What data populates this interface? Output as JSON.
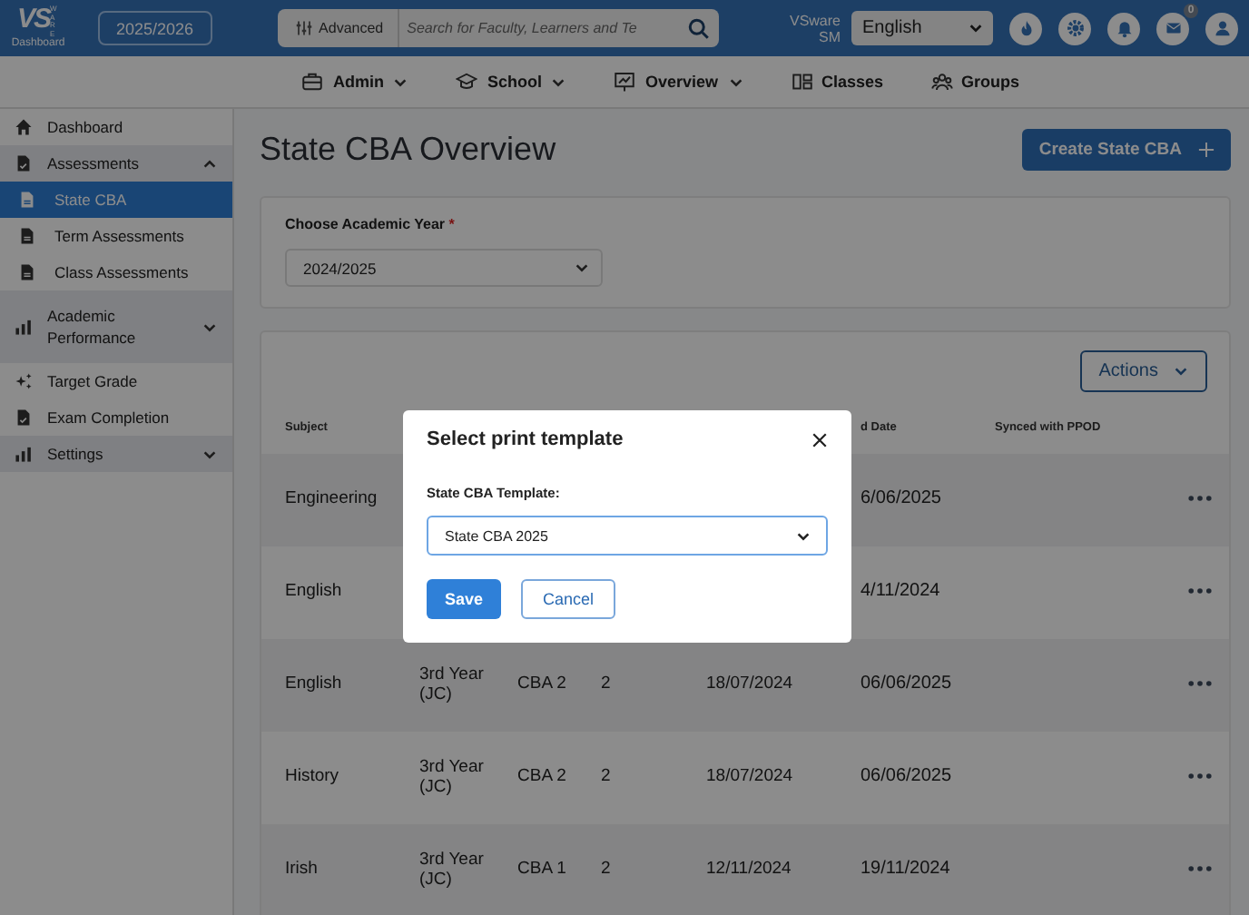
{
  "header": {
    "logo": {
      "mark": "VS",
      "side": "WARE",
      "caption": "Dashboard"
    },
    "year": "2025/2026",
    "advanced": "Advanced",
    "search": {
      "placeholder": "Search for Faculty, Learners and Te"
    },
    "org": [
      "VSware",
      "SM"
    ],
    "language": "English",
    "mail_badge": "0"
  },
  "nav": [
    {
      "label": "Admin",
      "caret": true
    },
    {
      "label": "School",
      "caret": true
    },
    {
      "label": "Overview",
      "caret": true
    },
    {
      "label": "Classes",
      "caret": false
    },
    {
      "label": "Groups",
      "caret": false
    }
  ],
  "sidebar": [
    {
      "label": "Dashboard",
      "kind": "link",
      "selected": false
    },
    {
      "label": "Assessments",
      "kind": "group",
      "expanded": true,
      "children": [
        {
          "label": "State CBA",
          "selected": true
        },
        {
          "label": "Term Assessments",
          "selected": false
        },
        {
          "label": "Class Assessments",
          "selected": false
        }
      ]
    },
    {
      "label": "Academic Performance",
      "kind": "group",
      "expanded": false
    },
    {
      "label": "Target Grade",
      "kind": "link",
      "selected": false
    },
    {
      "label": "Exam Completion",
      "kind": "link",
      "selected": false
    },
    {
      "label": "Settings",
      "kind": "group",
      "expanded": false
    }
  ],
  "page": {
    "title": "State CBA Overview",
    "create_button": "Create State CBA",
    "filter": {
      "label": "Choose Academic Year",
      "required": "*",
      "value": "2024/2025"
    },
    "actions_button": "Actions"
  },
  "table": {
    "columns": [
      "Subject",
      "",
      "",
      "",
      "",
      "d Date",
      "Synced with PPOD"
    ],
    "rows": [
      {
        "cells": [
          "Engineering",
          "",
          "",
          "",
          "",
          "6/06/2025"
        ]
      },
      {
        "cells": [
          "English",
          "",
          "",
          "",
          "",
          "4/11/2024"
        ]
      },
      {
        "cells": [
          "English",
          "3rd Year (JC)",
          "CBA 2",
          "2",
          "18/07/2024",
          "06/06/2025"
        ]
      },
      {
        "cells": [
          "History",
          "3rd Year (JC)",
          "CBA 2",
          "2",
          "18/07/2024",
          "06/06/2025"
        ]
      },
      {
        "cells": [
          "Irish",
          "3rd Year (JC)",
          "CBA 1",
          "2",
          "12/11/2024",
          "19/11/2024"
        ]
      }
    ]
  },
  "modal": {
    "title": "Select print template",
    "label": "State CBA Template:",
    "value": "State CBA 2025",
    "save": "Save",
    "cancel": "Cancel"
  }
}
